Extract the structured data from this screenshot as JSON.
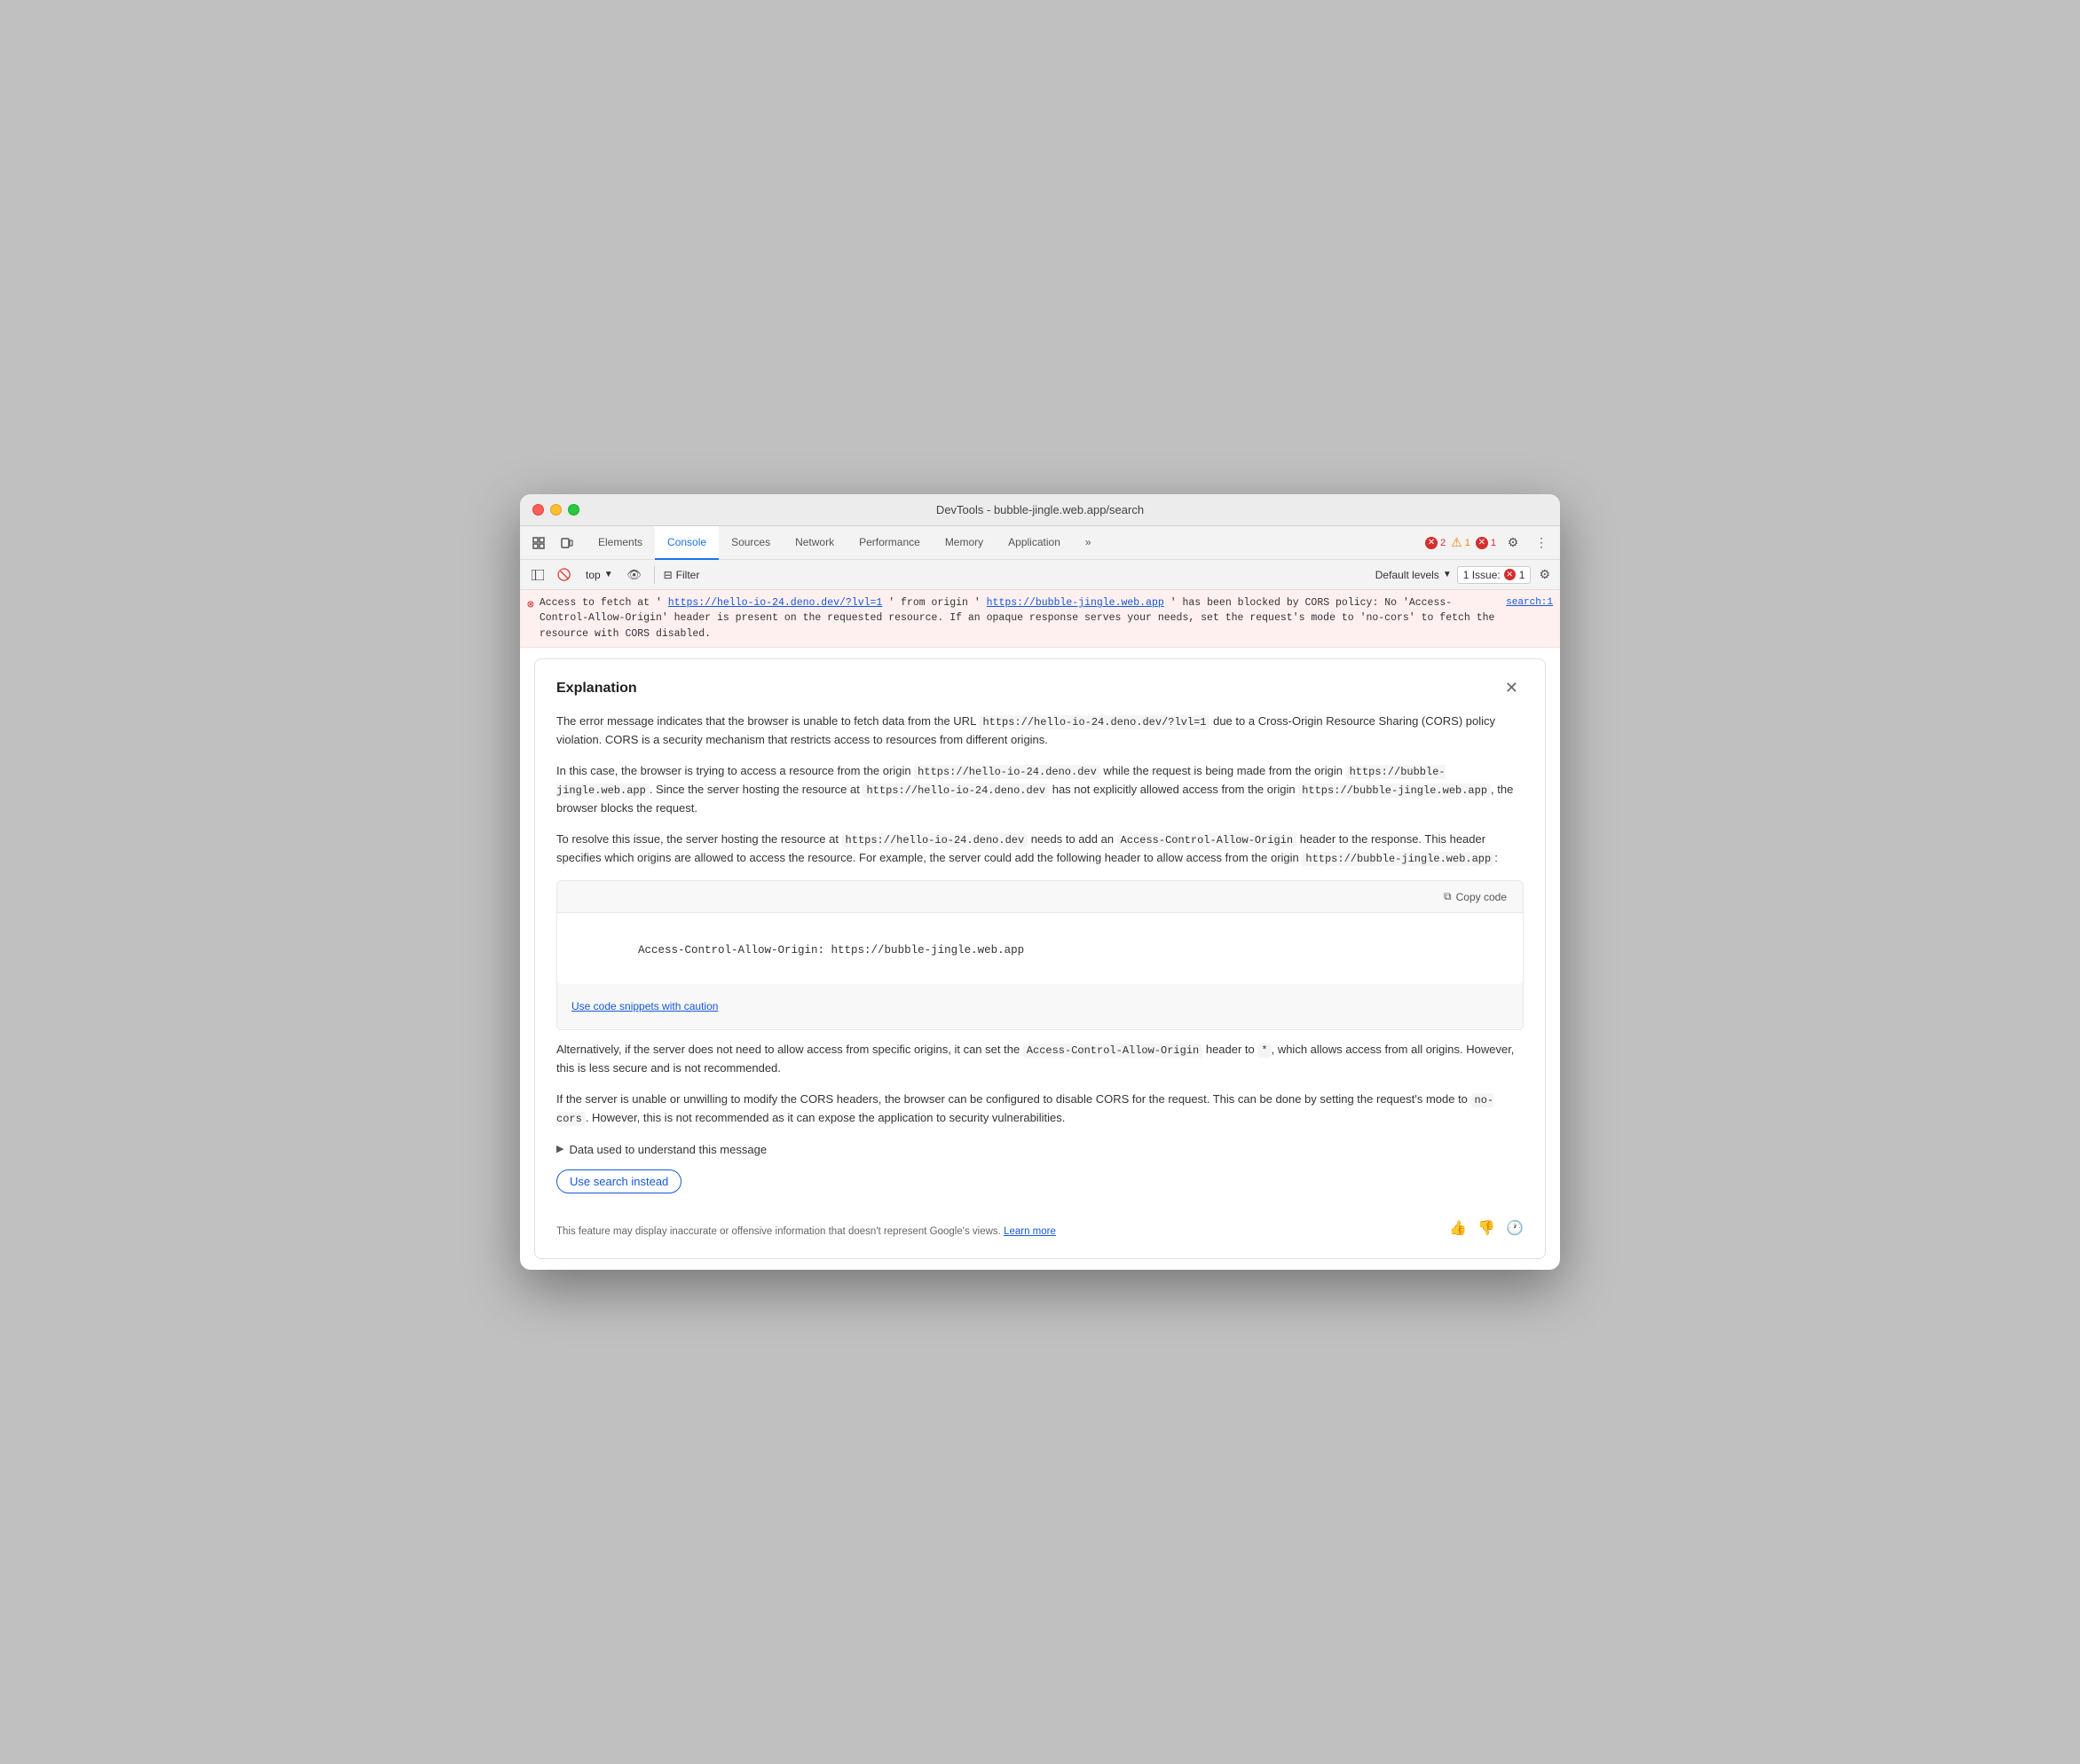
{
  "window": {
    "title": "DevTools - bubble-jingle.web.app/search"
  },
  "tabs": {
    "items": [
      {
        "label": "Elements",
        "active": false
      },
      {
        "label": "Console",
        "active": true
      },
      {
        "label": "Sources",
        "active": false
      },
      {
        "label": "Network",
        "active": false
      },
      {
        "label": "Performance",
        "active": false
      },
      {
        "label": "Memory",
        "active": false
      },
      {
        "label": "Application",
        "active": false
      }
    ],
    "more_label": "»",
    "error_count": "2",
    "warn_count": "1",
    "info_count": "1"
  },
  "toolbar": {
    "top_label": "top",
    "filter_label": "Filter",
    "levels_label": "Default levels",
    "issue_label": "1 Issue:",
    "issue_count": "1"
  },
  "error": {
    "main_text_1": "Access to fetch at '",
    "url1": "https://hello-io-24.deno.dev/?lvl=1",
    "main_text_2": "' from origin '",
    "url2": "https://bubble-jingle.web.app",
    "main_text_3": "' has been blocked by CORS policy: No 'Access-Control-Allow-Origin' header is present on the requested resource. If an opaque response serves your needs, set the request's mode to 'no-cors' to fetch the resource with CORS disabled.",
    "source_link": "search:1"
  },
  "explanation": {
    "title": "Explanation",
    "para1": "The error message indicates that the browser is unable to fetch data from the URL",
    "para1_code": "https://hello-io-24.deno.dev/?lvl=1",
    "para1_cont": "due to a Cross-Origin Resource Sharing (CORS) policy violation. CORS is a security mechanism that restricts access to resources from different origins.",
    "para2": "In this case, the browser is trying to access a resource from the origin",
    "para2_code1": "https://hello-io-24.deno.dev",
    "para2_text2": "while the request is being made from the origin",
    "para2_code2": "https://bubble-jingle.web.app",
    "para2_text3": ". Since the server hosting the resource at",
    "para2_code3": "https://hello-io-24.deno.dev",
    "para2_text4": "has not explicitly allowed access from the origin",
    "para2_code4": "https://bubble-jingle.web.app",
    "para2_text5": ", the browser blocks the request.",
    "para3": "To resolve this issue, the server hosting the resource at",
    "para3_code1": "https://hello-io-24.deno.dev",
    "para3_text2": "needs to add an",
    "para3_code2": "Access-Control-Allow-Origin",
    "para3_text3": "header to the response. This header specifies which origins are allowed to access the resource. For example, the server could add the following header to allow access from the origin",
    "para3_code3": "https://bubble-jingle.web.app",
    "para3_text4": ":",
    "copy_code_label": "Copy code",
    "code_snippet": "Access-Control-Allow-Origin: https://bubble-jingle.web.app",
    "caution_link": "Use code snippets with caution",
    "para4": "Alternatively, if the server does not need to allow access from specific origins, it can set the",
    "para4_code": "Access-Control-Allow-Origin",
    "para4_text2": "header to",
    "para4_code2": "*",
    "para4_text3": ", which allows access from all origins. However, this is less secure and is not recommended.",
    "para5": "If the server is unable or unwilling to modify the CORS headers, the browser can be configured to disable CORS for the request. This can be done by setting the request's mode to",
    "para5_code": "no-cors",
    "para5_text2": ". However, this is not recommended as it can expose the application to security vulnerabilities.",
    "data_used_label": "Data used to understand this message",
    "use_search_label": "Use search instead",
    "disclaimer": "This feature may display inaccurate or offensive information that doesn't represent Google's views.",
    "learn_more": "Learn more"
  }
}
